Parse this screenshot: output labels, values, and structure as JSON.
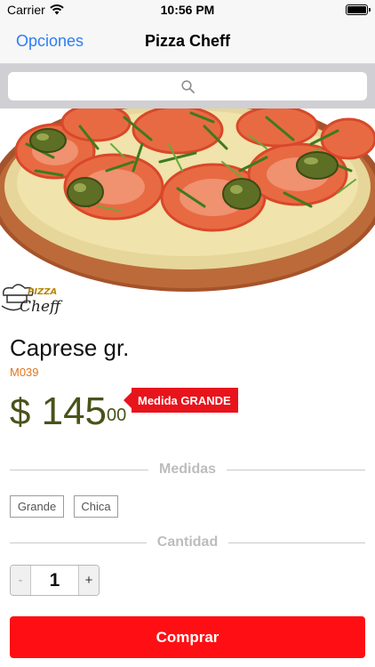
{
  "status_bar": {
    "carrier": "Carrier",
    "time": "10:56 PM",
    "battery_percent": 100
  },
  "nav": {
    "back_label": "Opciones",
    "title": "Pizza Cheff"
  },
  "search": {
    "placeholder": "",
    "icon": "search-icon"
  },
  "brand": {
    "logo_text_top": "PIZZA",
    "logo_text_bottom": "Cheff"
  },
  "product": {
    "name": "Caprese gr.",
    "code": "M039",
    "price_symbol": "$",
    "price_integer": "145",
    "price_cents": "00",
    "size_badge": "Medida GRANDE"
  },
  "sections": {
    "sizes_label": "Medidas",
    "quantity_label": "Cantidad"
  },
  "size_options": [
    "Grande",
    "Chica"
  ],
  "quantity": {
    "decrement": "-",
    "value": "1",
    "increment": "+"
  },
  "actions": {
    "buy_label": "Comprar"
  },
  "colors": {
    "accent_blue": "#2e7cf6",
    "price_green": "#4b521a",
    "code_orange": "#e2761c",
    "badge_red": "#e8141c",
    "buy_red": "#ff0f14"
  }
}
